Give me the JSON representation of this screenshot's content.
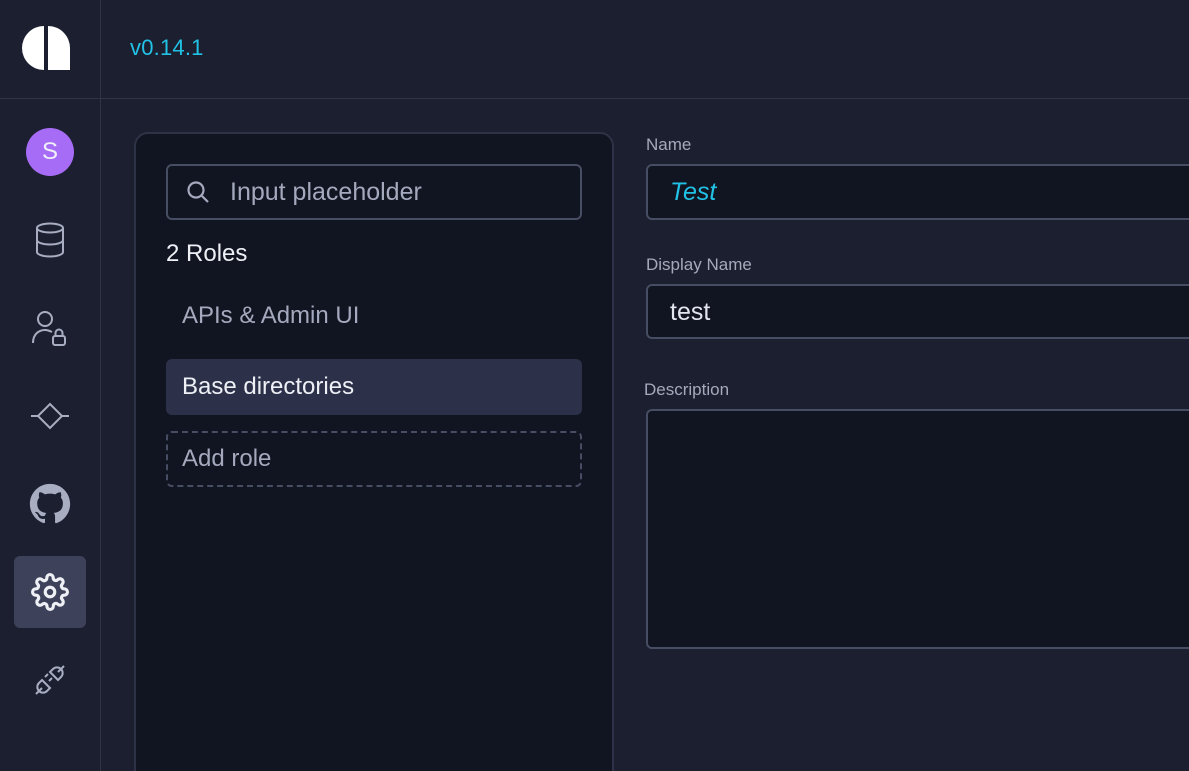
{
  "header": {
    "version": "v0.14.1"
  },
  "sidebar": {
    "avatar_initial": "S",
    "items": [
      {
        "name": "avatar"
      },
      {
        "icon": "database-icon"
      },
      {
        "icon": "user-lock-icon"
      },
      {
        "icon": "diamond-arrows-icon"
      },
      {
        "icon": "github-icon"
      },
      {
        "icon": "gear-icon",
        "active": true
      },
      {
        "icon": "plug-icon"
      }
    ]
  },
  "roles": {
    "search_placeholder": "Input placeholder",
    "count_label": "2 Roles",
    "items": [
      {
        "label": "APIs & Admin UI",
        "selected": false
      },
      {
        "label": "Base directories",
        "selected": true
      }
    ],
    "add_label": "Add role"
  },
  "form": {
    "name_label": "Name",
    "name_value": "Test",
    "display_name_label": "Display Name",
    "display_name_value": "test",
    "description_label": "Description",
    "description_value": ""
  },
  "colors": {
    "accent": "#22c2e6",
    "avatar": "#a76cf6",
    "background": "#1b1f2f",
    "panel": "#111421"
  }
}
